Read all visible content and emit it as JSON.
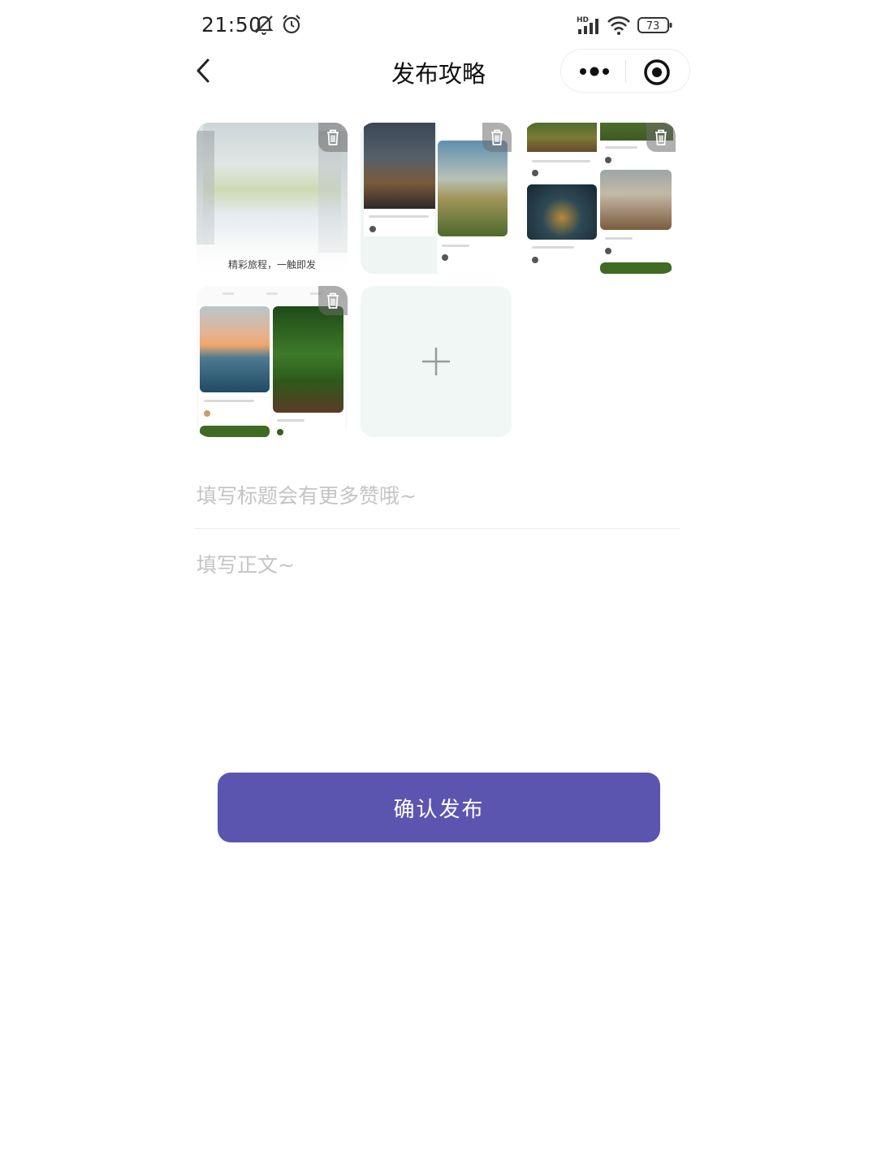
{
  "status_bar": {
    "time": "21:50",
    "network_label": "HD",
    "battery": "73"
  },
  "nav": {
    "title": "发布攻略"
  },
  "images": [
    {
      "caption": "精彩旅程，一触即发"
    },
    {
      "caption": ""
    },
    {
      "caption": ""
    },
    {
      "caption": ""
    }
  ],
  "form": {
    "title_placeholder": "填写标题会有更多赞哦~",
    "body_placeholder": "填写正文~",
    "submit_label": "确认发布"
  },
  "colors": {
    "primary": "#5c55b0",
    "add_tile_bg": "#f0f7f5"
  }
}
